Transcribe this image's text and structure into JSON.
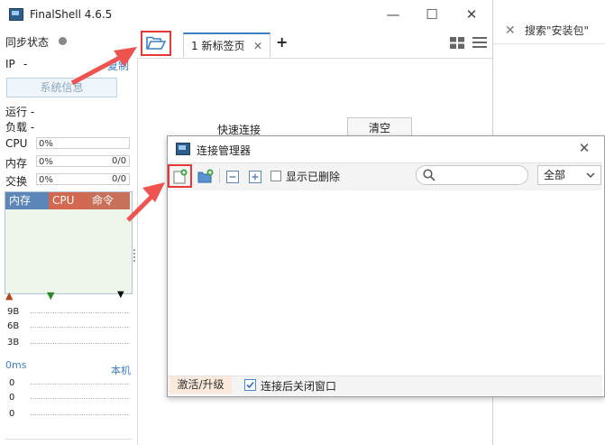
{
  "background_window": {
    "search_placeholder": "搜索\"安装包\""
  },
  "app": {
    "title": "FinalShell 4.6.5"
  },
  "window_controls": {
    "minimize": "—",
    "maximize": "☐",
    "close": "✕"
  },
  "sidebar": {
    "sync_label": "同步状态",
    "ip_label": "IP",
    "ip_value": "-",
    "copy_label": "复制",
    "sysinfo_button": "系统信息",
    "running_label": "运行 -",
    "load_label": "负载 -",
    "stats": [
      {
        "label": "CPU",
        "value": "0%",
        "extra": ""
      },
      {
        "label": "内存",
        "value": "0%",
        "extra": "0/0"
      },
      {
        "label": "交换",
        "value": "0%",
        "extra": "0/0"
      }
    ],
    "proc_headers": [
      "内存",
      "CPU",
      "命令"
    ],
    "proc_header_colors": [
      "#5b86b7",
      "#d2684f",
      "#c9705a"
    ],
    "net_labels": [
      "9B",
      "6B",
      "3B"
    ],
    "latency_label": "0ms",
    "local_label": "本机",
    "latency_values": [
      "0",
      "0",
      "0"
    ]
  },
  "tabs": {
    "items": [
      {
        "label": "1 新标签页",
        "close": "✕"
      }
    ],
    "add": "+"
  },
  "quick_connect": {
    "label": "快速连接",
    "clear_button": "清空"
  },
  "conn_manager": {
    "title": "连接管理器",
    "close": "✕",
    "show_deleted": "显示已删除",
    "filter_selected": "全部",
    "activate": "激活/升级",
    "close_after_connect": "连接后关闭窗口"
  },
  "colors": {
    "accent_red": "#e53935",
    "brand_blue": "#3c7fc8"
  }
}
